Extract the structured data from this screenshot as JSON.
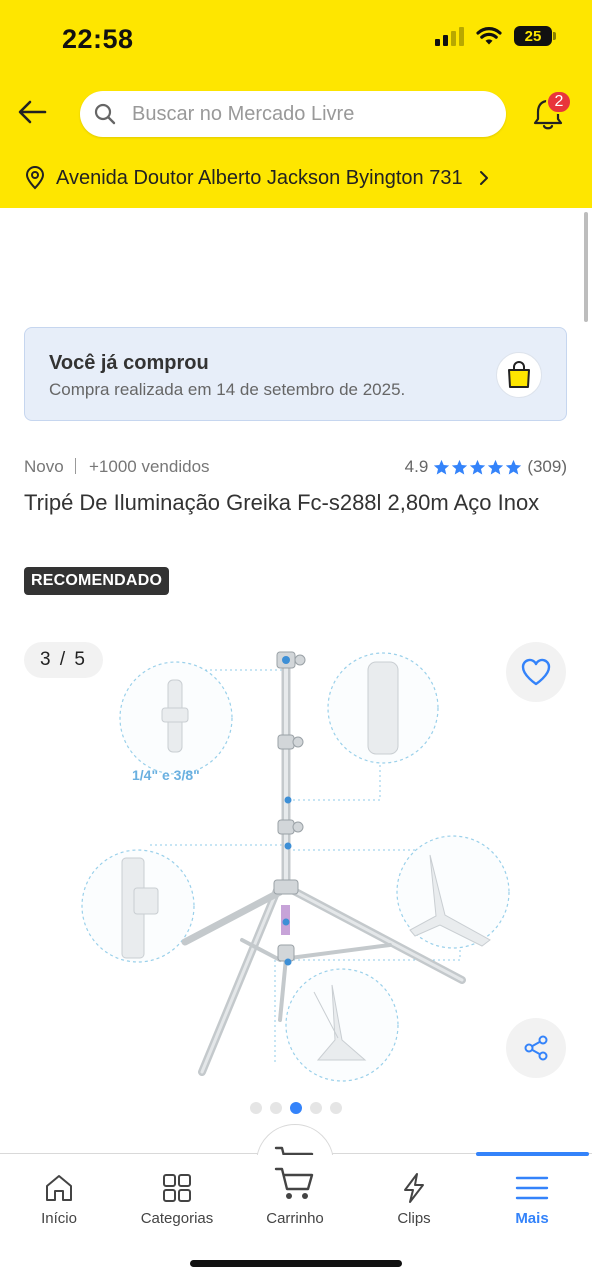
{
  "status_bar": {
    "time": "22:58",
    "battery": "25",
    "icons": [
      "signal-icon",
      "wifi-icon",
      "battery-icon"
    ]
  },
  "header": {
    "search_placeholder": "Buscar no Mercado Livre",
    "notification_count": "2",
    "address": "Avenida Doutor Alberto Jackson Byington 731",
    "background_color": "#fee600"
  },
  "purchase_notice": {
    "title": "Você já comprou",
    "subtitle": "Compra realizada em 14 de setembro de 2025."
  },
  "product": {
    "condition": "Novo",
    "sold": "+1000 vendidos",
    "rating": "4.9",
    "stars": 5,
    "reviews": "(309)",
    "title": "Tripé De Iluminação Greika Fc-s288l 2,80m Aço Inox",
    "badge": "RECOMENDADO"
  },
  "gallery": {
    "counter": "3 / 5",
    "current_index": 3,
    "total": 5,
    "image_caption": "1/4\" e  3/8\""
  },
  "bottom_nav": {
    "items": [
      {
        "label": "Início",
        "icon": "home-icon"
      },
      {
        "label": "Categorias",
        "icon": "grid-icon"
      },
      {
        "label": "Carrinho",
        "icon": "cart-icon"
      },
      {
        "label": "Clips",
        "icon": "lightning-icon"
      },
      {
        "label": "Mais",
        "icon": "menu-icon",
        "active": true
      }
    ],
    "accent_color": "#3483fa"
  }
}
